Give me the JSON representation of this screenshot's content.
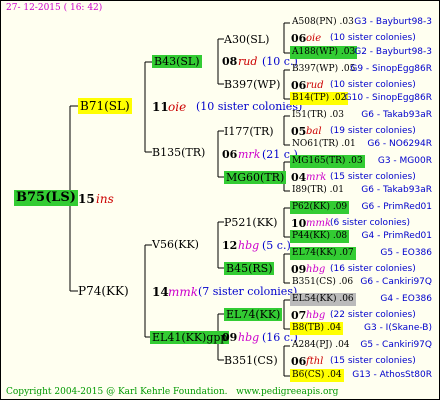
{
  "header": {
    "date": "27- 12-2015 ( 16: 42)"
  },
  "footer": {
    "copyright": "Copyright 2004-2015 @ Karl Kehrle Foundation.",
    "url": "www.pedigreeapis.org"
  },
  "root": {
    "label": "B75(LS)",
    "num": "15",
    "code": "ins"
  },
  "gen1": [
    {
      "label": "B71(SL)",
      "num": "11",
      "code": "oie",
      "note": "(10 sister colonies)"
    },
    {
      "label": "P74(KK)",
      "num": "14",
      "code": "mmk",
      "note": "(7 sister colonies)"
    }
  ],
  "gen2": [
    {
      "label": "B43(SL)"
    },
    {
      "label": "B135(TR)"
    },
    {
      "label": "V56(KK)"
    },
    {
      "label": "EL41(KK)gpp"
    }
  ],
  "gen3": [
    {
      "label": "A30(SL)",
      "num": "08",
      "code": "rud",
      "note": "(10 c.)"
    },
    {
      "label": "B397(WP)"
    },
    {
      "label": "I177(TR)",
      "num": "06",
      "code": "mrk",
      "note": "(21 c.)"
    },
    {
      "label": "MG60(TR)"
    },
    {
      "label": "P521(KK)",
      "num": "12",
      "code": "hbg",
      "note": "(5 c.)"
    },
    {
      "label": "B45(RS)"
    },
    {
      "label": "EL74(KK)",
      "num": "09",
      "code": "hbg",
      "note": "(16 c.)"
    },
    {
      "label": "B351(CS)"
    }
  ],
  "gen4": [
    {
      "label": "A508(PN)",
      "val": ".03",
      "src": "G3 - Bayburt98-3"
    },
    {
      "num": "06",
      "code": "oie",
      "note": "(10 sister colonies)"
    },
    {
      "label": "A188(WP)",
      "val": ".03",
      "src": "G2 - Bayburt98-3"
    },
    {
      "label": "B397(WP)",
      "val": ".05",
      "src": "G9 - SinopEgg86R"
    },
    {
      "num": "06",
      "code": "rud",
      "note": "(10 sister colonies)"
    },
    {
      "label": "B14(TP)",
      "val": ".02",
      "src": "G10 - SinopEgg86R"
    },
    {
      "label": "I51(TR)",
      "val": ".03",
      "src": "G6 - Takab93aR"
    },
    {
      "num": "05",
      "code": "bal",
      "note": "(19 sister colonies)"
    },
    {
      "label": "NO61(TR)",
      "val": ".01",
      "src": "G6 - NO6294R"
    },
    {
      "label": "MG165(TR)",
      "val": ".03",
      "src": "G3 - MG00R"
    },
    {
      "num": "04",
      "code": "mrk",
      "note": "(15 sister colonies)"
    },
    {
      "label": "I89(TR)",
      "val": ".01",
      "src": "G6 - Takab93aR"
    },
    {
      "label": "P62(KK)",
      "val": ".09",
      "src": "G6 - PrimRed01"
    },
    {
      "num": "10",
      "code": "mmk",
      "note": "(6 sister colonies)"
    },
    {
      "label": "P44(KK)",
      "val": ".08",
      "src": "G4 - PrimRed01"
    },
    {
      "label": "EL74(KK)",
      "val": ".07",
      "src": "G5 - EO386"
    },
    {
      "num": "09",
      "code": "hbg",
      "note": "(16 sister colonies)"
    },
    {
      "label": "B351(CS)",
      "val": ".06",
      "src": "G6 - Cankiri97Q"
    },
    {
      "label": "EL54(KK)",
      "val": ".06",
      "src": "G4 - EO386"
    },
    {
      "num": "07",
      "code": "hbg",
      "note": "(22 sister colonies)"
    },
    {
      "label": "B8(TB)",
      "val": ".04",
      "src": "G3 - I(Skane-B)"
    },
    {
      "label": "A284(PJ)",
      "val": ".04",
      "src": "G5 - Cankiri97Q"
    },
    {
      "num": "06",
      "code": "fthl",
      "note": "(15 sister colonies)"
    },
    {
      "label": "B6(CS)",
      "val": ".04",
      "src": "G13 - AthosSt80R"
    }
  ]
}
